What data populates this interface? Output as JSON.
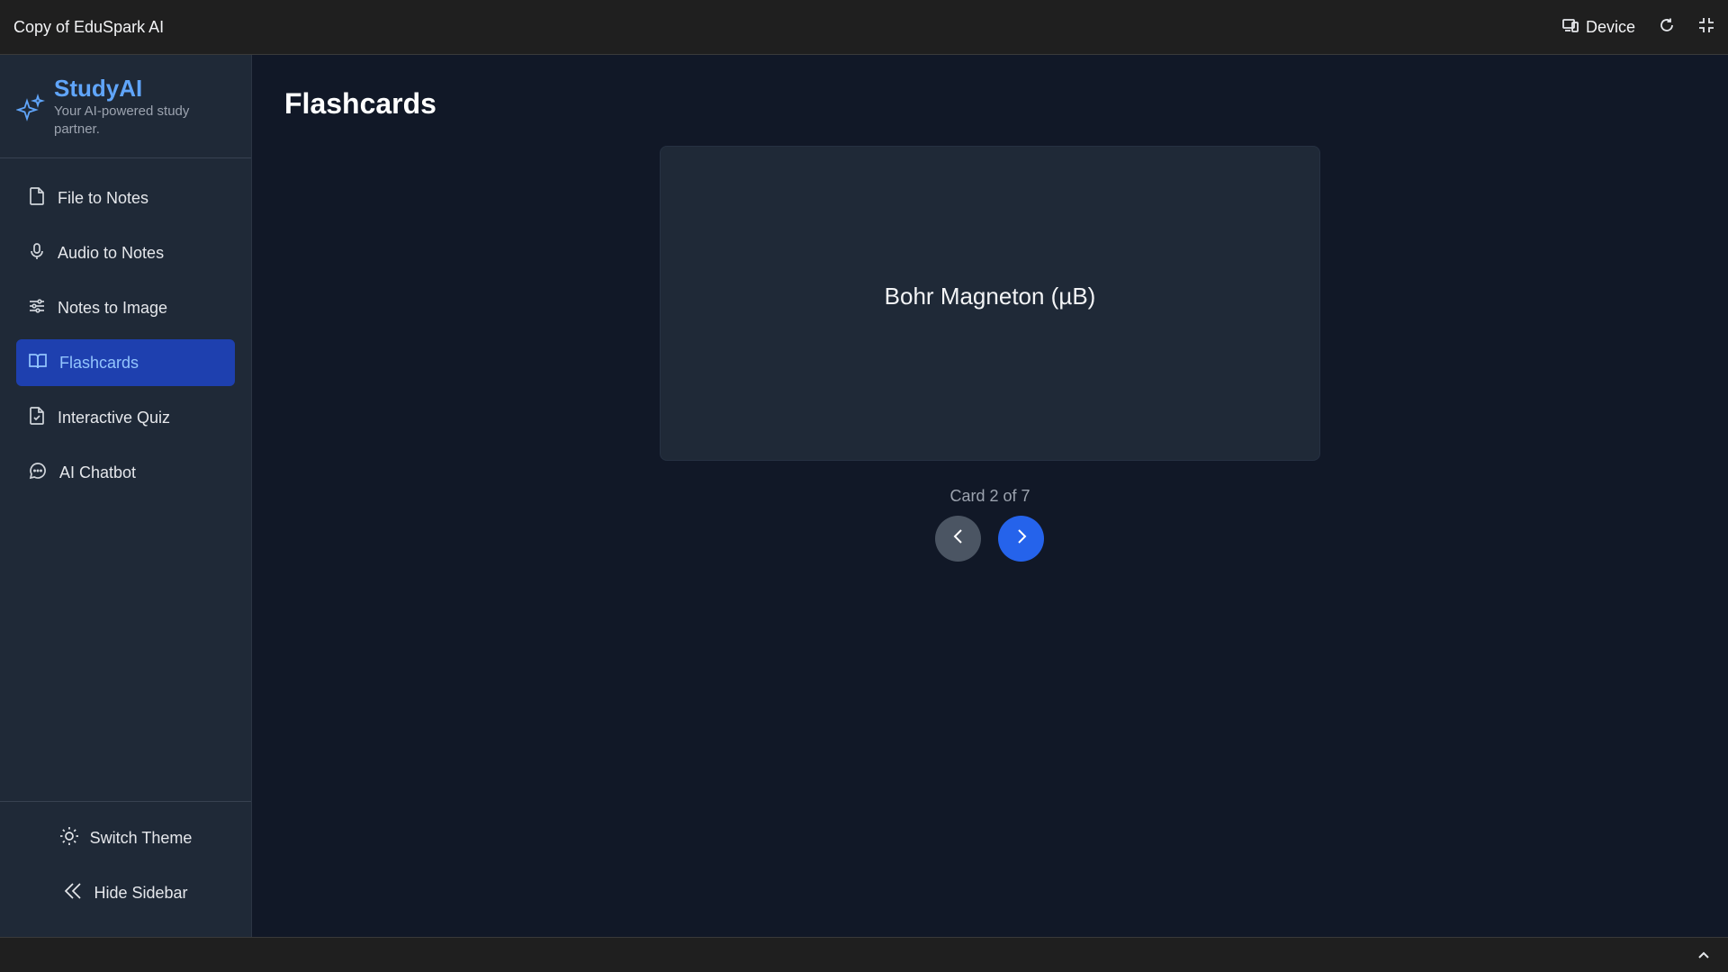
{
  "window": {
    "title": "Copy of EduSpark AI",
    "device_label": "Device"
  },
  "sidebar": {
    "brand_name": "StudyAI",
    "brand_tagline": "Your AI-powered study partner.",
    "items": [
      {
        "label": "File to Notes",
        "icon": "file-icon"
      },
      {
        "label": "Audio to Notes",
        "icon": "microphone-icon"
      },
      {
        "label": "Notes to Image",
        "icon": "sliders-icon"
      },
      {
        "label": "Flashcards",
        "icon": "book-open-icon",
        "active": true
      },
      {
        "label": "Interactive Quiz",
        "icon": "file-check-icon"
      },
      {
        "label": "AI Chatbot",
        "icon": "chat-bubble-icon"
      }
    ],
    "footer": {
      "switch_theme": "Switch Theme",
      "hide_sidebar": "Hide Sidebar"
    }
  },
  "main": {
    "page_title": "Flashcards",
    "card_text": "Bohr Magneton (µB)",
    "counter": "Card 2 of 7"
  },
  "colors": {
    "accent": "#2563eb",
    "active_nav_bg": "#1e40af",
    "brand": "#60a5fa",
    "background": "#111827",
    "sidebar_bg": "#1f2937"
  }
}
